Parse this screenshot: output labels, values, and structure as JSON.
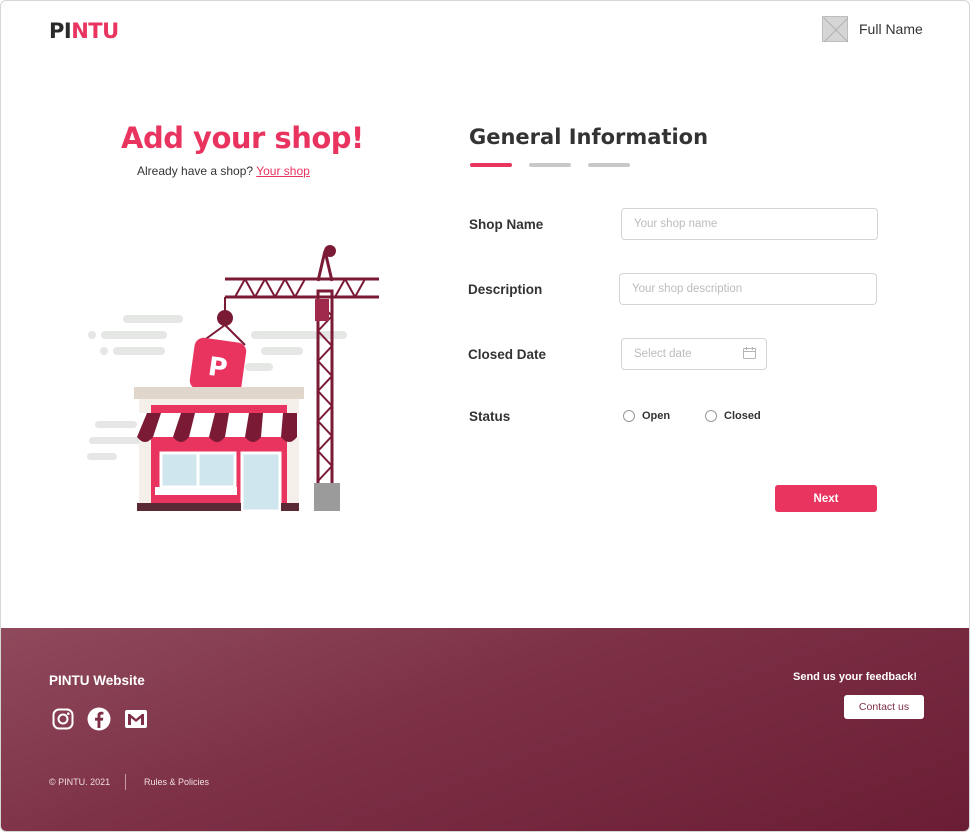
{
  "brand": {
    "logo_part1": "PI",
    "logo_part2": "NTU"
  },
  "user": {
    "name": "Full Name"
  },
  "hero": {
    "title": "Add your shop!",
    "subtitle": "Already have a shop?",
    "link": "Your shop",
    "sign_letter": "P"
  },
  "form": {
    "title": "General Information",
    "steps": [
      {
        "active": true
      },
      {
        "active": false
      },
      {
        "active": false
      }
    ],
    "shop_name": {
      "label": "Shop Name",
      "placeholder": "Your shop name",
      "value": ""
    },
    "description": {
      "label": "Description",
      "placeholder": "Your shop description",
      "value": ""
    },
    "closed_date": {
      "label": "Closed Date",
      "placeholder": "Select date",
      "value": ""
    },
    "status": {
      "label": "Status",
      "options": [
        "Open",
        "Closed"
      ]
    },
    "next_label": "Next"
  },
  "footer": {
    "title": "PINTU Website",
    "social_icons": [
      "instagram-icon",
      "facebook-icon",
      "mail-icon"
    ],
    "feedback": "Send us your feedback!",
    "contact_label": "Contact us",
    "copyright": "© PINTU. 2021",
    "rules": "Rules & Policies"
  },
  "colors": {
    "accent": "#e8345f",
    "footer": "#7c2f45",
    "crane": "#7a1a35"
  }
}
